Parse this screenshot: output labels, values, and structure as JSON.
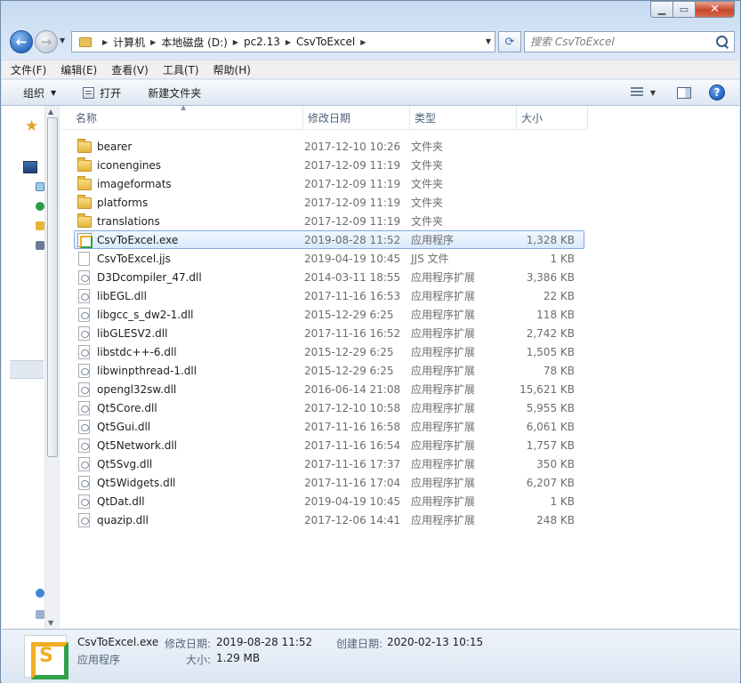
{
  "window": {
    "minimize_icon": "minimize-icon",
    "maximize_icon": "maximize-icon",
    "close_icon": "close-icon"
  },
  "address": {
    "crumbs": [
      "计算机",
      "本地磁盘 (D:)",
      "pc2.13",
      "CsvToExcel"
    ]
  },
  "search": {
    "placeholder": "搜索 CsvToExcel"
  },
  "menu": [
    "文件(F)",
    "编辑(E)",
    "查看(V)",
    "工具(T)",
    "帮助(H)"
  ],
  "commands": {
    "organize": "组织",
    "open": "打开",
    "new_folder": "新建文件夹"
  },
  "columns": {
    "name": "名称",
    "date": "修改日期",
    "type": "类型",
    "size": "大小"
  },
  "files": [
    {
      "name": "bearer",
      "date": "2017-12-10 10:26",
      "type": "文件夹",
      "size": "",
      "icon": "folder"
    },
    {
      "name": "iconengines",
      "date": "2017-12-09 11:19",
      "type": "文件夹",
      "size": "",
      "icon": "folder"
    },
    {
      "name": "imageformats",
      "date": "2017-12-09 11:19",
      "type": "文件夹",
      "size": "",
      "icon": "folder"
    },
    {
      "name": "platforms",
      "date": "2017-12-09 11:19",
      "type": "文件夹",
      "size": "",
      "icon": "folder"
    },
    {
      "name": "translations",
      "date": "2017-12-09 11:19",
      "type": "文件夹",
      "size": "",
      "icon": "folder"
    },
    {
      "name": "CsvToExcel.exe",
      "date": "2019-08-28 11:52",
      "type": "应用程序",
      "size": "1,328 KB",
      "icon": "exe",
      "selected": true
    },
    {
      "name": "CsvToExcel.jjs",
      "date": "2019-04-19 10:45",
      "type": "JJS 文件",
      "size": "1 KB",
      "icon": "doc"
    },
    {
      "name": "D3Dcompiler_47.dll",
      "date": "2014-03-11 18:55",
      "type": "应用程序扩展",
      "size": "3,386 KB",
      "icon": "dll"
    },
    {
      "name": "libEGL.dll",
      "date": "2017-11-16 16:53",
      "type": "应用程序扩展",
      "size": "22 KB",
      "icon": "dll"
    },
    {
      "name": "libgcc_s_dw2-1.dll",
      "date": "2015-12-29 6:25",
      "type": "应用程序扩展",
      "size": "118 KB",
      "icon": "dll"
    },
    {
      "name": "libGLESV2.dll",
      "date": "2017-11-16 16:52",
      "type": "应用程序扩展",
      "size": "2,742 KB",
      "icon": "dll"
    },
    {
      "name": "libstdc++-6.dll",
      "date": "2015-12-29 6:25",
      "type": "应用程序扩展",
      "size": "1,505 KB",
      "icon": "dll"
    },
    {
      "name": "libwinpthread-1.dll",
      "date": "2015-12-29 6:25",
      "type": "应用程序扩展",
      "size": "78 KB",
      "icon": "dll"
    },
    {
      "name": "opengl32sw.dll",
      "date": "2016-06-14 21:08",
      "type": "应用程序扩展",
      "size": "15,621 KB",
      "icon": "dll"
    },
    {
      "name": "Qt5Core.dll",
      "date": "2017-12-10 10:58",
      "type": "应用程序扩展",
      "size": "5,955 KB",
      "icon": "dll"
    },
    {
      "name": "Qt5Gui.dll",
      "date": "2017-11-16 16:58",
      "type": "应用程序扩展",
      "size": "6,061 KB",
      "icon": "dll"
    },
    {
      "name": "Qt5Network.dll",
      "date": "2017-11-16 16:54",
      "type": "应用程序扩展",
      "size": "1,757 KB",
      "icon": "dll"
    },
    {
      "name": "Qt5Svg.dll",
      "date": "2017-11-16 17:37",
      "type": "应用程序扩展",
      "size": "350 KB",
      "icon": "dll"
    },
    {
      "name": "Qt5Widgets.dll",
      "date": "2017-11-16 17:04",
      "type": "应用程序扩展",
      "size": "6,207 KB",
      "icon": "dll"
    },
    {
      "name": "QtDat.dll",
      "date": "2019-04-19 10:45",
      "type": "应用程序扩展",
      "size": "1 KB",
      "icon": "dll"
    },
    {
      "name": "quazip.dll",
      "date": "2017-12-06 14:41",
      "type": "应用程序扩展",
      "size": "248 KB",
      "icon": "dll"
    }
  ],
  "details": {
    "filename": "CsvToExcel.exe",
    "filetype": "应用程序",
    "modified_label": "修改日期:",
    "modified_value": "2019-08-28 11:52",
    "created_label": "创建日期:",
    "created_value": "2020-02-13 10:15",
    "size_label": "大小:",
    "size_value": "1.29 MB"
  },
  "colors": {
    "selection_bg": "#d9e9fb",
    "selection_border": "#84acdd",
    "folder": "#e6b53a"
  }
}
